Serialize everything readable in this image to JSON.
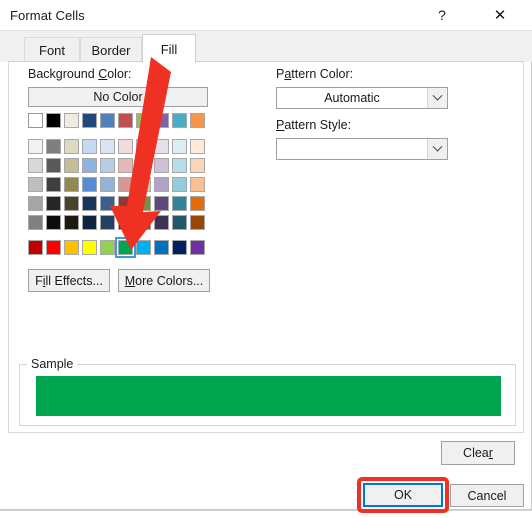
{
  "window": {
    "title": "Format Cells",
    "help_icon": "question-mark-icon",
    "close_icon": "close-x-icon",
    "help_label": "?",
    "close_label": "✕"
  },
  "tabs": [
    {
      "label": "Font",
      "active": false
    },
    {
      "label": "Border",
      "active": false
    },
    {
      "label": "Fill",
      "active": true
    }
  ],
  "fill_tab": {
    "background_color": {
      "label_prefix": "Background ",
      "label_accel": "C",
      "label_suffix": "olor:",
      "no_color_button": "No Color",
      "selected_swatch_name": "green",
      "selected_swatch_hex": "#00A550",
      "theme_colors": [
        "#FFFFFF",
        "#000000",
        "#EEECE1",
        "#1F497D",
        "#4F81BD",
        "#C0504D",
        "#9BBB59",
        "#8064A2",
        "#4BACC6",
        "#F79646"
      ],
      "shade_rows": [
        [
          "#F2F2F2",
          "#7F7F7F",
          "#DDD9C3",
          "#C6D9F0",
          "#DBE5F1",
          "#F2DCDB",
          "#EBF1DD",
          "#E5E0EC",
          "#DBEEF3",
          "#FDEADA"
        ],
        [
          "#D8D8D8",
          "#595959",
          "#C4BD97",
          "#8DB3E2",
          "#B8CCE4",
          "#E5B9B7",
          "#D7E3BC",
          "#CCC1D9",
          "#B7DDE8",
          "#FBD5B5"
        ],
        [
          "#BFBFBF",
          "#3F3F3F",
          "#938953",
          "#548DD4",
          "#95B3D7",
          "#D99694",
          "#C3D69B",
          "#B2A2C7",
          "#92CDDC",
          "#FAC08F"
        ],
        [
          "#A5A5A5",
          "#262626",
          "#494429",
          "#17365D",
          "#366092",
          "#953734",
          "#76923C",
          "#5F497A",
          "#31859B",
          "#E36C09"
        ],
        [
          "#808080",
          "#0C0C0C",
          "#1D1B10",
          "#0F243E",
          "#244061",
          "#632423",
          "#4F6128",
          "#3F3151",
          "#205867",
          "#974806"
        ]
      ],
      "standard_colors": [
        "#C00000",
        "#FF0000",
        "#FFC000",
        "#FFFF00",
        "#92D050",
        "#00A550",
        "#00B0F0",
        "#0070C0",
        "#002060",
        "#7030A0"
      ],
      "fill_effects_button": {
        "prefix": "F",
        "accel": "i",
        "suffix": "ll Effects..."
      },
      "more_colors_button": {
        "accel": "M",
        "suffix": "ore Colors..."
      }
    },
    "pattern_color": {
      "label_prefix": "P",
      "label_accel": "a",
      "label_suffix": "ttern Color:",
      "value": "Automatic",
      "chevron_icon": "chevron-down-icon"
    },
    "pattern_style": {
      "label_accel": "P",
      "label_suffix": "attern Style:",
      "value": "",
      "chevron_icon": "chevron-down-icon"
    },
    "sample": {
      "legend": "Sample",
      "fill_hex": "#00A550"
    },
    "clear_button": {
      "prefix": "Clea",
      "accel": "r"
    }
  },
  "footer": {
    "ok_label": "OK",
    "cancel_label": "Cancel",
    "ok_highlight_hex": "#EF3124",
    "ok_focus_hex": "#0078D7"
  },
  "annotation": {
    "arrow_color": "#EF3124",
    "arrow_name": "red-pointer-arrow",
    "points_to": "green standard color swatch"
  }
}
